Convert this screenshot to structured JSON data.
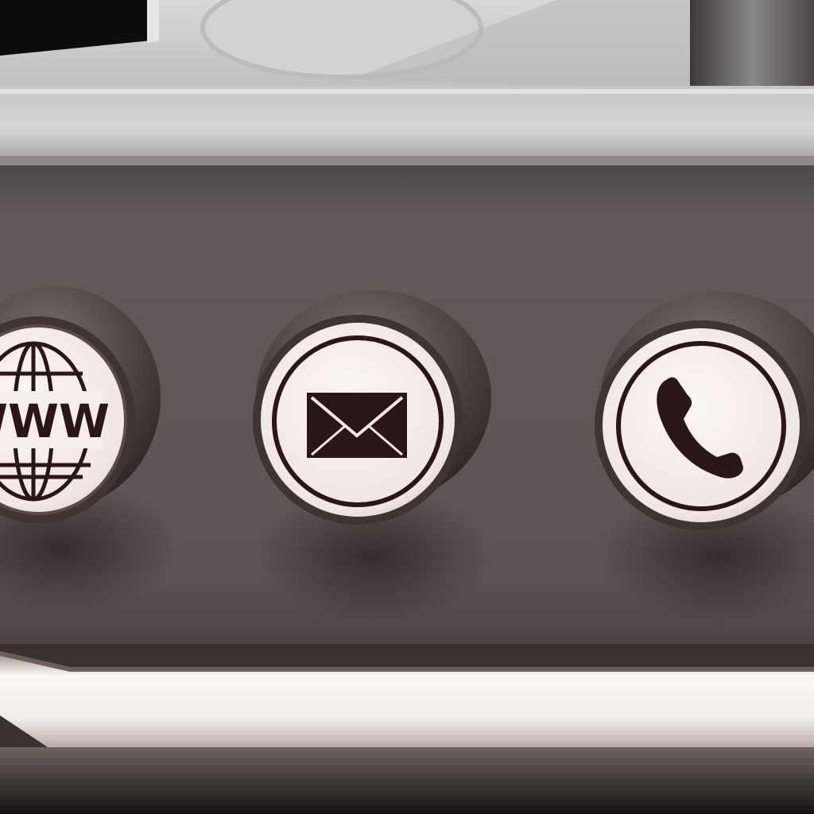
{
  "panel": {
    "buttons": [
      {
        "id": "web",
        "icon": "globe-www-icon",
        "label": "WWW"
      },
      {
        "id": "email",
        "icon": "envelope-icon"
      },
      {
        "id": "phone",
        "icon": "phone-handset-icon"
      }
    ]
  },
  "colors": {
    "panel_face": "#5e5656",
    "button_face": "#f4ecea",
    "button_rim": "#5a4a48",
    "icon_ink": "#2a1616",
    "top_bezel": "#c9c9c9",
    "bottom_trim": "#f3f0ec"
  }
}
